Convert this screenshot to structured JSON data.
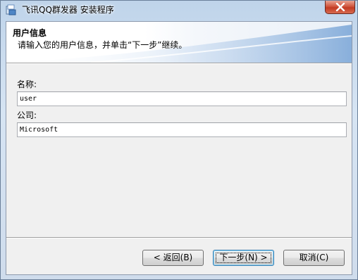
{
  "window": {
    "title": "飞讯QQ群发器 安装程序",
    "app_icon": "installer-icon",
    "close_icon": "close-icon"
  },
  "banner": {
    "title": "用户信息",
    "subtitle": "请输入您的用户信息，并单击“下一步”继续。"
  },
  "form": {
    "name_label": "名称:",
    "name_value": "user",
    "company_label": "公司:",
    "company_value": "Microsoft"
  },
  "buttons": {
    "back": "< 返回(B)",
    "next": "下一步(N) >",
    "cancel": "取消(C)"
  },
  "colors": {
    "close_button": "#c23a22",
    "default_button_border": "#3c7fb1"
  }
}
